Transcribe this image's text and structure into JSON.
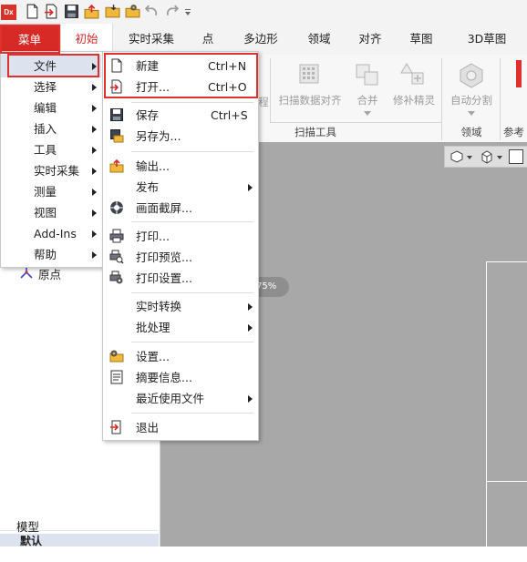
{
  "app": {
    "logo_text": "Dx"
  },
  "quick_access": {
    "icons": [
      "new-document-icon",
      "open-icon",
      "save-icon",
      "export-icon",
      "folder-icon",
      "settings-folder-icon",
      "undo-icon",
      "redo-icon",
      "customize-dropdown-icon"
    ]
  },
  "tabs": {
    "menu": "菜单",
    "items": [
      "初始",
      "实时采集",
      "点",
      "多边形",
      "领域",
      "对齐",
      "草图",
      "3D草图"
    ],
    "active": "初始"
  },
  "ribbon": {
    "partial_label": "程",
    "scan_align": "扫描数据对齐",
    "merge": "合并",
    "patch_wizard": "修补精灵",
    "scan_tools_group": "扫描工具",
    "auto_split": "自动分割",
    "region_group": "领域",
    "ref_group_partial": "参考"
  },
  "main_menu": {
    "items": [
      {
        "label": "文件",
        "submenu": true,
        "highlighted": true
      },
      {
        "label": "选择",
        "submenu": true
      },
      {
        "label": "编辑",
        "submenu": true
      },
      {
        "label": "插入",
        "submenu": true
      },
      {
        "label": "工具",
        "submenu": true
      },
      {
        "label": "实时采集",
        "submenu": true
      },
      {
        "label": "测量",
        "submenu": true
      },
      {
        "label": "视图",
        "submenu": true
      },
      {
        "label": "Add-Ins",
        "submenu": true
      },
      {
        "label": "帮助",
        "submenu": true
      }
    ]
  },
  "file_menu": {
    "new": {
      "label": "新建",
      "shortcut": "Ctrl+N"
    },
    "open": {
      "label": "打开...",
      "shortcut": "Ctrl+O"
    },
    "save": {
      "label": "保存",
      "shortcut": "Ctrl+S"
    },
    "save_as": {
      "label": "另存为..."
    },
    "export": {
      "label": "输出..."
    },
    "publish": {
      "label": "发布"
    },
    "screenshot": {
      "label": "画面截屏..."
    },
    "print": {
      "label": "打印..."
    },
    "print_preview": {
      "label": "打印预览..."
    },
    "print_setup": {
      "label": "打印设置..."
    },
    "realtime_convert": {
      "label": "实时转换"
    },
    "batch": {
      "label": "批处理"
    },
    "settings": {
      "label": "设置..."
    },
    "summary": {
      "label": "摘要信息..."
    },
    "recent": {
      "label": "最近使用文件"
    },
    "exit": {
      "label": "退出"
    }
  },
  "left_panel": {
    "origin": "原点",
    "model_label": "模型",
    "default_label": "默认"
  },
  "zoom_badge": "175%",
  "colors": {
    "accent_red": "#d72a27",
    "canvas_gray": "#a8a8a8"
  }
}
